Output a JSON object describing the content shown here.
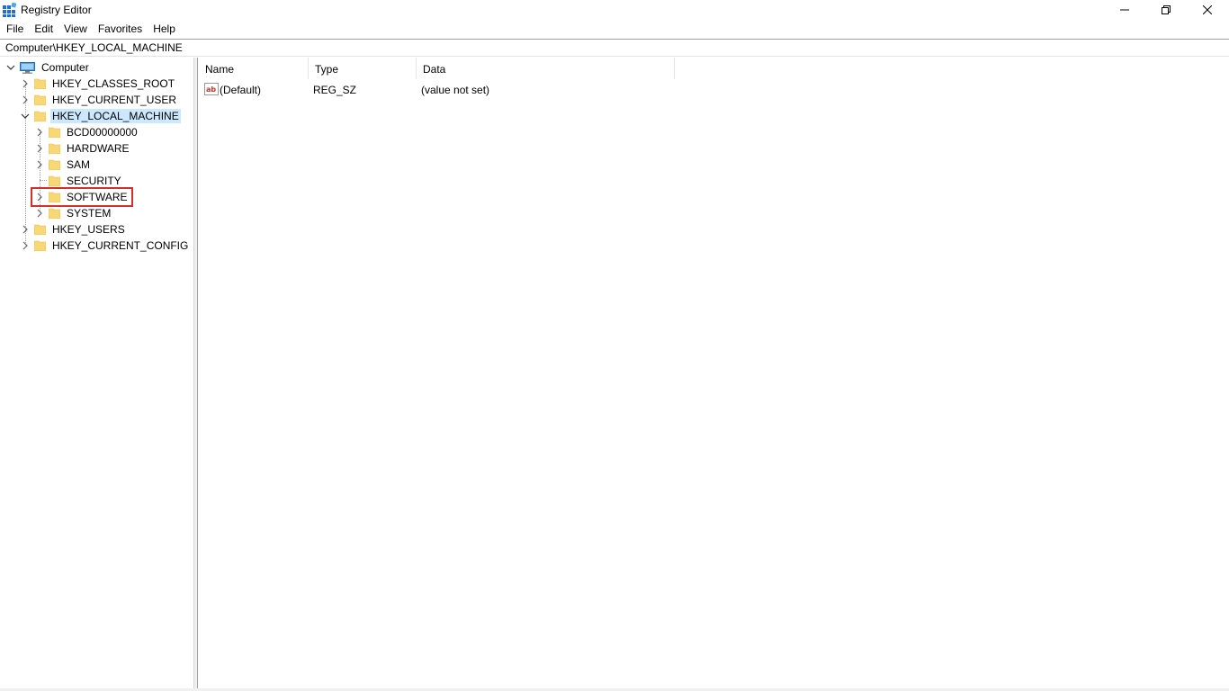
{
  "window": {
    "title": "Registry Editor"
  },
  "menu": [
    "File",
    "Edit",
    "View",
    "Favorites",
    "Help"
  ],
  "address": {
    "path": "Computer\\HKEY_LOCAL_MACHINE"
  },
  "tree": {
    "root": "Computer",
    "hkeys": {
      "classes_root": "HKEY_CLASSES_ROOT",
      "current_user": "HKEY_CURRENT_USER",
      "local_machine": "HKEY_LOCAL_MACHINE",
      "users": "HKEY_USERS",
      "current_config": "HKEY_CURRENT_CONFIG"
    },
    "local_machine_children": {
      "bcd": "BCD00000000",
      "hardware": "HARDWARE",
      "sam": "SAM",
      "security": "SECURITY",
      "software": "SOFTWARE",
      "system": "SYSTEM"
    },
    "selected": "HKEY_LOCAL_MACHINE",
    "highlighted": "SOFTWARE"
  },
  "list": {
    "columns": {
      "name": "Name",
      "type": "Type",
      "data": "Data"
    },
    "rows": [
      {
        "name": "(Default)",
        "type": "REG_SZ",
        "data": "(value not set)",
        "icon": "string-value-icon"
      }
    ]
  },
  "colors": {
    "selection": "#cce8ff",
    "highlight_border": "#d0312d",
    "folder": "#f8d775"
  }
}
